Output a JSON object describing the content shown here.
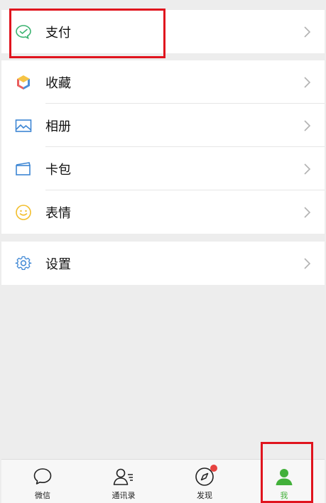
{
  "groups": {
    "pay": {
      "items": [
        {
          "label": "支付",
          "icon": "wechat-pay-icon"
        }
      ]
    },
    "tools": {
      "items": [
        {
          "label": "收藏",
          "icon": "favorites-cube-icon"
        },
        {
          "label": "相册",
          "icon": "album-picture-icon"
        },
        {
          "label": "卡包",
          "icon": "card-wallet-icon"
        },
        {
          "label": "表情",
          "icon": "smiley-face-icon"
        }
      ]
    },
    "settings": {
      "items": [
        {
          "label": "设置",
          "icon": "gear-icon"
        }
      ]
    }
  },
  "tabbar": {
    "tabs": [
      {
        "label": "微信",
        "icon": "chat-bubble-icon"
      },
      {
        "label": "通讯录",
        "icon": "contacts-icon"
      },
      {
        "label": "发现",
        "icon": "compass-icon",
        "badge": true
      },
      {
        "label": "我",
        "icon": "person-icon",
        "active": true
      }
    ]
  },
  "colors": {
    "accent_green": "#42b03a",
    "badge_red": "#e64340",
    "annotation_red": "#e0141e"
  }
}
